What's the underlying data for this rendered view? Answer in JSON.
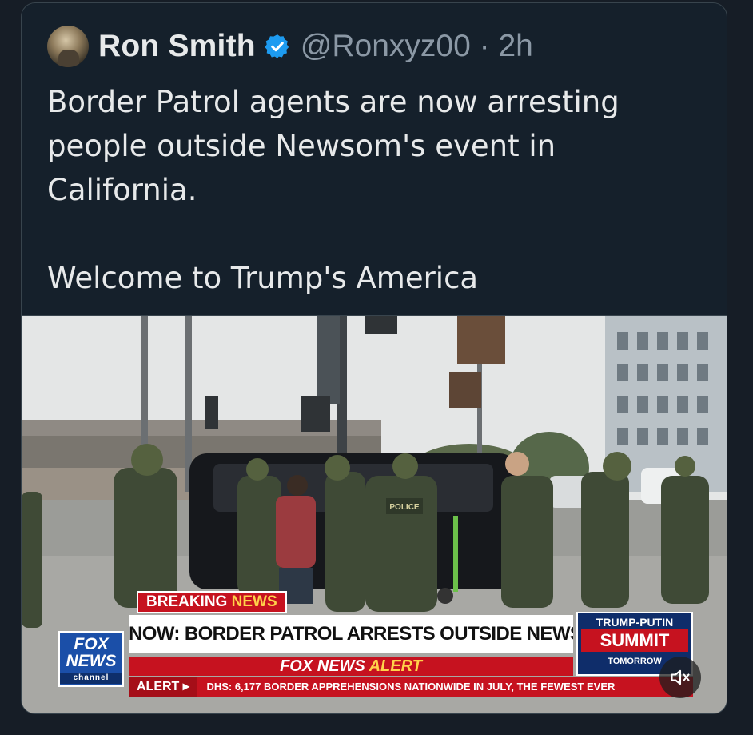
{
  "tweet": {
    "author_name": "Ron Smith",
    "handle": "@Ronxyz00",
    "time": "· 2h",
    "text_lines": [
      "Border Patrol agents are now arresting",
      "people outside Newsom's event in",
      "California.",
      "Welcome to Trump's America"
    ],
    "verified_icon": "verified-badge-icon"
  },
  "media": {
    "breaking_label": "BREAKING",
    "breaking_news": "NEWS",
    "headline": "NOW: BORDER PATROL ARRESTS OUTSIDE NEWSOM EVENT",
    "alert_prefix": "FOX NEWS",
    "alert_word": "ALERT",
    "ticker_tag": "ALERT",
    "ticker_text": "DHS: 6,177 BORDER APPREHENSIONS NATIONWIDE IN JULY, THE FEWEST EVER",
    "logo_line1": "FOX",
    "logo_line2": "NEWS",
    "logo_line3": "channel",
    "summit_top": "TRUMP-PUTIN",
    "summit_main": "SUMMIT",
    "summit_bottom": "TOMORROW",
    "vest_label": "POLICE",
    "mute_icon": "speaker-muted-icon"
  },
  "colors": {
    "background": "#15202b",
    "text": "#e7e9ea",
    "muted": "#8b98a5",
    "verified": "#1d9bf0",
    "fox_red": "#c6121f",
    "fox_blue": "#1b4fa8"
  }
}
